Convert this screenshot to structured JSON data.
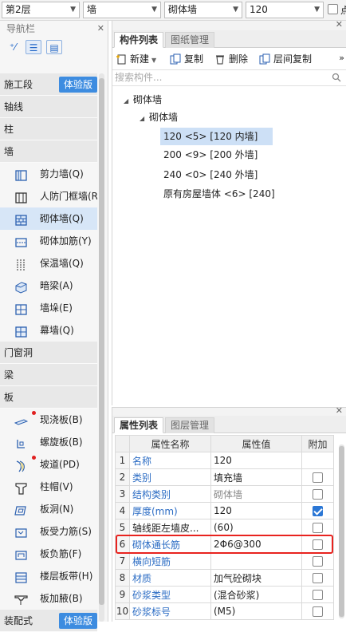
{
  "topbar": {
    "floor": "第2层",
    "category": "墙",
    "type": "砌体墙",
    "size": "120",
    "check_label": "点"
  },
  "nav": {
    "title": "导航栏",
    "sections": [
      {
        "label": "施工段",
        "badge": "体验版"
      },
      {
        "label": "轴线"
      },
      {
        "label": "柱"
      },
      {
        "label": "墙"
      }
    ],
    "wall_items": [
      {
        "label": "剪力墙(Q)",
        "icon": "shear-wall-icon"
      },
      {
        "label": "人防门框墙(R",
        "icon": "civil-defense-door-wall-icon"
      },
      {
        "label": "砌体墙(Q)",
        "icon": "masonry-wall-icon"
      },
      {
        "label": "砌体加筋(Y)",
        "icon": "masonry-reinforcement-icon"
      },
      {
        "label": "保温墙(Q)",
        "icon": "insulation-wall-icon"
      },
      {
        "label": "暗梁(A)",
        "icon": "hidden-beam-icon"
      },
      {
        "label": "墙垛(E)",
        "icon": "wall-pier-icon"
      },
      {
        "label": "幕墙(Q)",
        "icon": "curtain-wall-icon"
      }
    ],
    "sections2": [
      "门窗洞",
      "梁",
      "板"
    ],
    "slab_items": [
      {
        "label": "现浇板(B)",
        "icon": "cast-slab-icon",
        "dot": true
      },
      {
        "label": "螺旋板(B)",
        "icon": "spiral-slab-icon",
        "dot": false
      },
      {
        "label": "坡道(PD)",
        "icon": "ramp-icon",
        "dot": true
      },
      {
        "label": "柱帽(V)",
        "icon": "column-cap-icon",
        "dot": false
      },
      {
        "label": "板洞(N)",
        "icon": "slab-hole-icon",
        "dot": false
      },
      {
        "label": "板受力筋(S)",
        "icon": "slab-stress-rebar-icon",
        "dot": false
      },
      {
        "label": "板负筋(F)",
        "icon": "slab-negative-rebar-icon",
        "dot": false
      },
      {
        "label": "楼层板带(H)",
        "icon": "floor-slab-strip-icon",
        "dot": false
      },
      {
        "label": "板加腋(B)",
        "icon": "slab-haunch-icon",
        "dot": false
      }
    ],
    "bottom_section": {
      "label": "装配式",
      "badge": "体验版"
    }
  },
  "component_panel": {
    "tabs": [
      "构件列表",
      "图纸管理"
    ],
    "toolbar": [
      "新建",
      "复制",
      "删除",
      "层间复制"
    ],
    "search_placeholder": "搜索构件...",
    "tree_root": "砌体墙",
    "tree_child": "砌体墙",
    "leaves": [
      "120 <5> [120 内墙]",
      "200 <9> [200 外墙]",
      "240 <0> [240 外墙]",
      "原有房屋墙体 <6> [240]"
    ]
  },
  "property_panel": {
    "tabs": [
      "属性列表",
      "图层管理"
    ],
    "headers": [
      "属性名称",
      "属性值",
      "附加"
    ],
    "rows": [
      {
        "num": "1",
        "name": "名称",
        "value": "120",
        "checkbox": "none"
      },
      {
        "num": "2",
        "name": "类别",
        "value": "填充墙",
        "checkbox": "off"
      },
      {
        "num": "3",
        "name": "结构类别",
        "value": "砌体墙",
        "checkbox": "off"
      },
      {
        "num": "4",
        "name": "厚度(mm)",
        "value": "120",
        "checkbox": "on"
      },
      {
        "num": "5",
        "name": "轴线距左墙皮...",
        "value": "(60)",
        "checkbox": "off"
      },
      {
        "num": "6",
        "name": "砌体通长筋",
        "value": "2Φ6@300",
        "checkbox": "off"
      },
      {
        "num": "7",
        "name": "横向短筋",
        "value": "",
        "checkbox": "off"
      },
      {
        "num": "8",
        "name": "材质",
        "value": "加气砼砌块",
        "checkbox": "off"
      },
      {
        "num": "9",
        "name": "砂浆类型",
        "value": "(混合砂浆)",
        "checkbox": "off"
      },
      {
        "num": "10",
        "name": "砂浆标号",
        "value": "(M5)",
        "checkbox": "off"
      }
    ]
  }
}
